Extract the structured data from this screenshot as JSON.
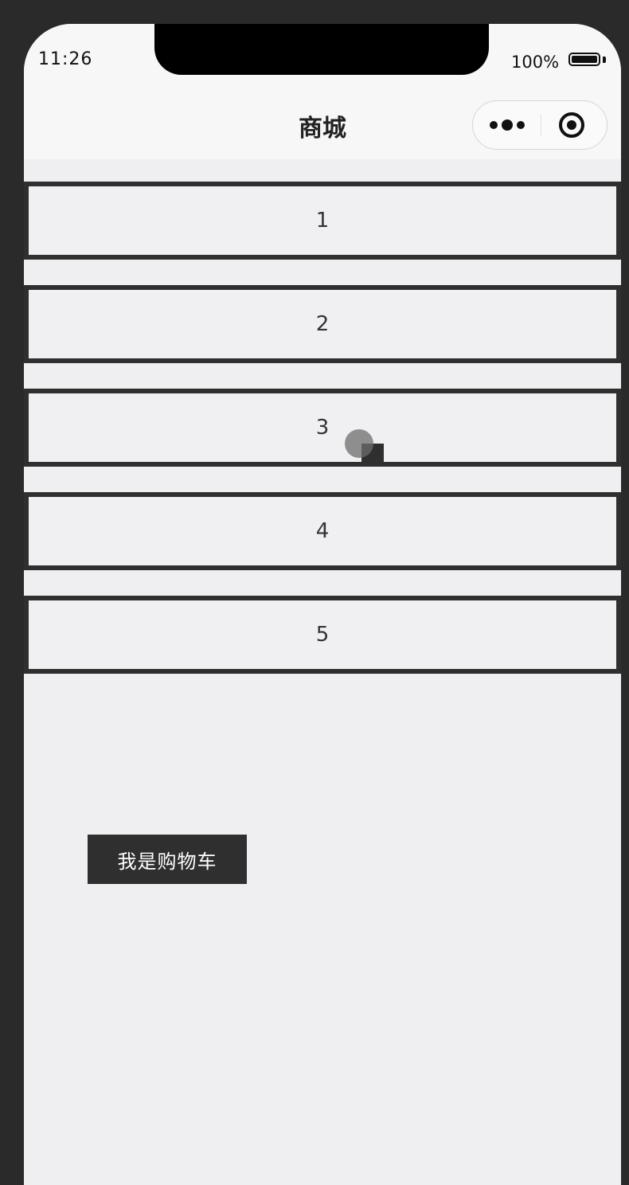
{
  "status_bar": {
    "time": "11:26",
    "battery": "100%"
  },
  "nav": {
    "title": "商城",
    "more_icon": "more-dots-icon",
    "close_icon": "target-close-icon"
  },
  "list": {
    "items": [
      "1",
      "2",
      "3",
      "4",
      "5"
    ]
  },
  "cart": {
    "label": "我是购物车"
  },
  "colors": {
    "background": "#2a2a2a",
    "page": "#efeff1",
    "border": "#2f2f2f",
    "button": "#2f2f2f",
    "button_text": "#ffffff"
  }
}
